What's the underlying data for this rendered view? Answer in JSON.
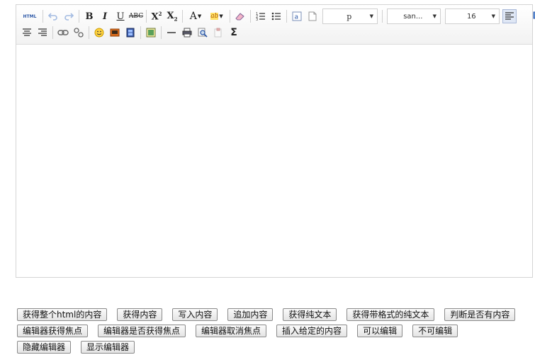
{
  "toolbar": {
    "html_label": "HTML",
    "bold": "B",
    "italic": "I",
    "underline": "U",
    "strike": "ABC",
    "superscript": "X",
    "sup_mark": "2",
    "subscript": "X",
    "sub_mark": "2",
    "font_color": "A",
    "highlight": "ab",
    "paragraph": "p",
    "font_family": "san...",
    "font_size": "16",
    "sigma": "Σ"
  },
  "buttons": [
    "获得整个html的内容",
    "获得内容",
    "写入内容",
    "追加内容",
    "获得纯文本",
    "获得带格式的纯文本",
    "判断是否有内容",
    "编辑器获得焦点",
    "编辑器是否获得焦点",
    "编辑器取消焦点",
    "插入给定的内容",
    "可以编辑",
    "不可编辑",
    "隐藏编辑器",
    "显示编辑器"
  ],
  "colors": {
    "accent": "#2f5aa8",
    "border": "#d4d4d4"
  }
}
